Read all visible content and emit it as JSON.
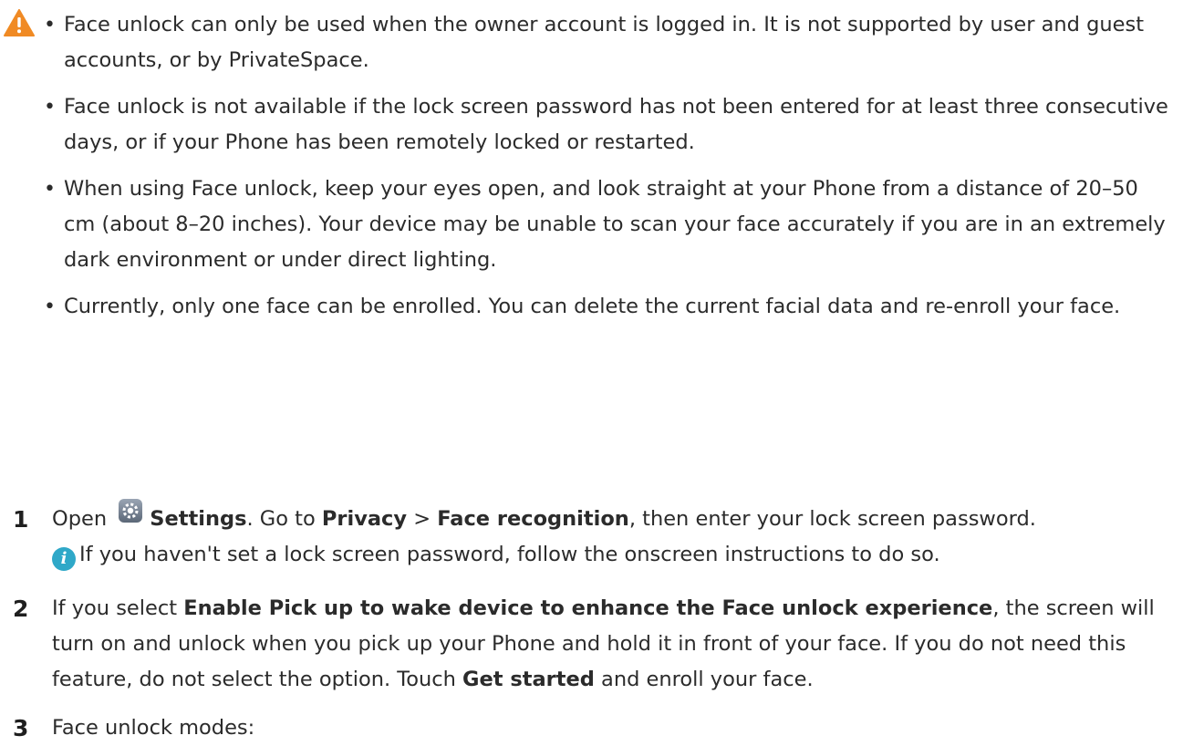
{
  "warning": {
    "icon": "warning-triangle-icon",
    "color": "#f08a24",
    "bullets": [
      "Face unlock can only be used when the owner account is logged in. It is not supported by user and guest accounts, or by PrivateSpace.",
      "Face unlock is not available if the lock screen password has not been entered for at least three consecutive days, or if your Phone has been remotely locked or restarted.",
      "When using Face unlock, keep your eyes open, and look straight at your Phone from a distance of 20–50 cm (about 8–20 inches). Your device may be unable to scan your face accurately if you are in an extremely dark environment or under direct lighting.",
      "Currently, only one face can be enrolled. You can delete the current facial data and re-enroll your face."
    ]
  },
  "steps": {
    "s1": {
      "num": "1",
      "open": "Open",
      "settings_icon": "settings-gear-icon",
      "settings": "Settings",
      "goto": ". Go to ",
      "privacy": "Privacy",
      "sep": " > ",
      "face_recognition": "Face recognition",
      "rest": ", then enter your lock screen password.",
      "note_icon": "info-icon",
      "note": "If you haven't set a lock screen password, follow the onscreen instructions to do so."
    },
    "s2": {
      "num": "2",
      "a": "If you select ",
      "b1": "Enable Pick up to wake device to enhance the Face unlock experience",
      "c": ", the screen will turn on and unlock when you pick up your Phone and hold it in front of your face. If you do not need this feature, do not select the option. Touch ",
      "b2": "Get started",
      "d": " and enroll your face."
    },
    "s3": {
      "num": "3",
      "text": "Face unlock modes:"
    }
  }
}
